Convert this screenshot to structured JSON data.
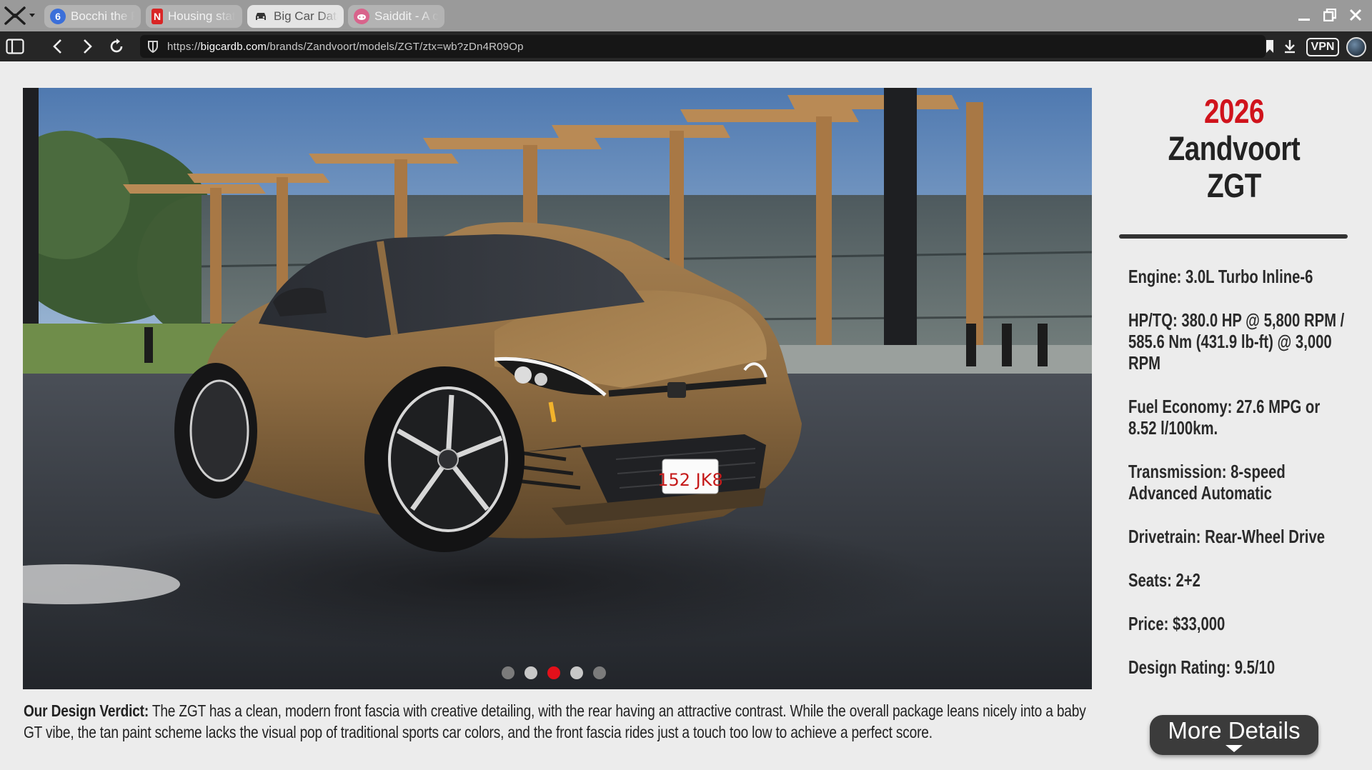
{
  "browser": {
    "tabs": [
      {
        "title": "Bocchi the R",
        "icon": "bocchi-favicon",
        "color": "#3b6fd9"
      },
      {
        "title": "Housing stat",
        "icon": "netflix-favicon",
        "color": "#d92525"
      },
      {
        "title": "Big Car Datal",
        "icon": "car-favicon",
        "color": "#444444",
        "active": true
      },
      {
        "title": "Saiddit - A c",
        "icon": "saiddit-favicon",
        "color": "#d8648c"
      }
    ],
    "url": {
      "prefix": "https://",
      "domain": "bigcardb.com",
      "path": "/brands/Zandvoort/models/ZGT/ztx=wb?zDn4R09Op"
    },
    "vpn_label": "VPN"
  },
  "vehicle": {
    "year": "2026",
    "make_model": "Zandvoort ZGT",
    "plate": "152 JK8",
    "specs": [
      "Engine: 3.0L Turbo Inline-6",
      "HP/TQ: 380.0 HP @ 5,800 RPM / 585.6 Nm (431.9 lb-ft) @ 3,000 RPM",
      "Fuel Economy: 27.6 MPG or 8.52 l/100km.",
      "Transmission: 8-speed Advanced Automatic",
      "Drivetrain: Rear-Wheel Drive",
      "Seats: 2+2",
      "Price: $33,000",
      "Design Rating: 9.5/10"
    ]
  },
  "verdict": {
    "label": "Our Design Verdict:",
    "text": " The ZGT has a clean, modern front fascia with creative detailing, with the rear having an attractive contrast. While the overall package leans nicely into a baby GT vibe, the tan paint scheme lacks the visual pop of traditional sports car colors, and the front fascia rides just a touch too low to achieve a perfect score."
  },
  "carousel": {
    "count": 5,
    "active_index": 2
  },
  "more_details_label": "More Details",
  "colors": {
    "accent": "#d0131c",
    "paint": "#9b7646"
  }
}
